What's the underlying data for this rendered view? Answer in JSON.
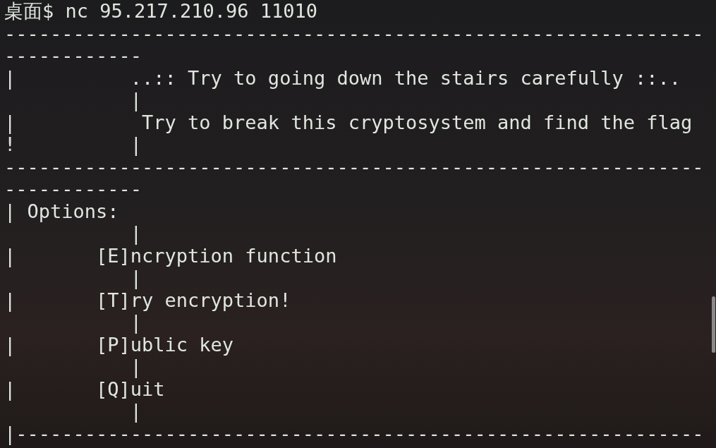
{
  "terminal": {
    "lines": [
      "桌面$ nc 95.217.210.96 11010",
      "-------------------------------------------------------------",
      "------------",
      "|          ..:: Try to going down the stairs carefully ::.. ",
      "           |",
      "|           Try to break this cryptosystem and find the flag",
      "!          |",
      "-------------------------------------------------------------",
      "------------",
      "| Options:",
      "           |",
      "|       [E]ncryption function",
      "           |",
      "|       [T]ry encryption!",
      "           |",
      "|       [P]ublic key",
      "           |",
      "|       [Q]uit",
      "           |",
      "|------------------------------------------------------------"
    ]
  }
}
